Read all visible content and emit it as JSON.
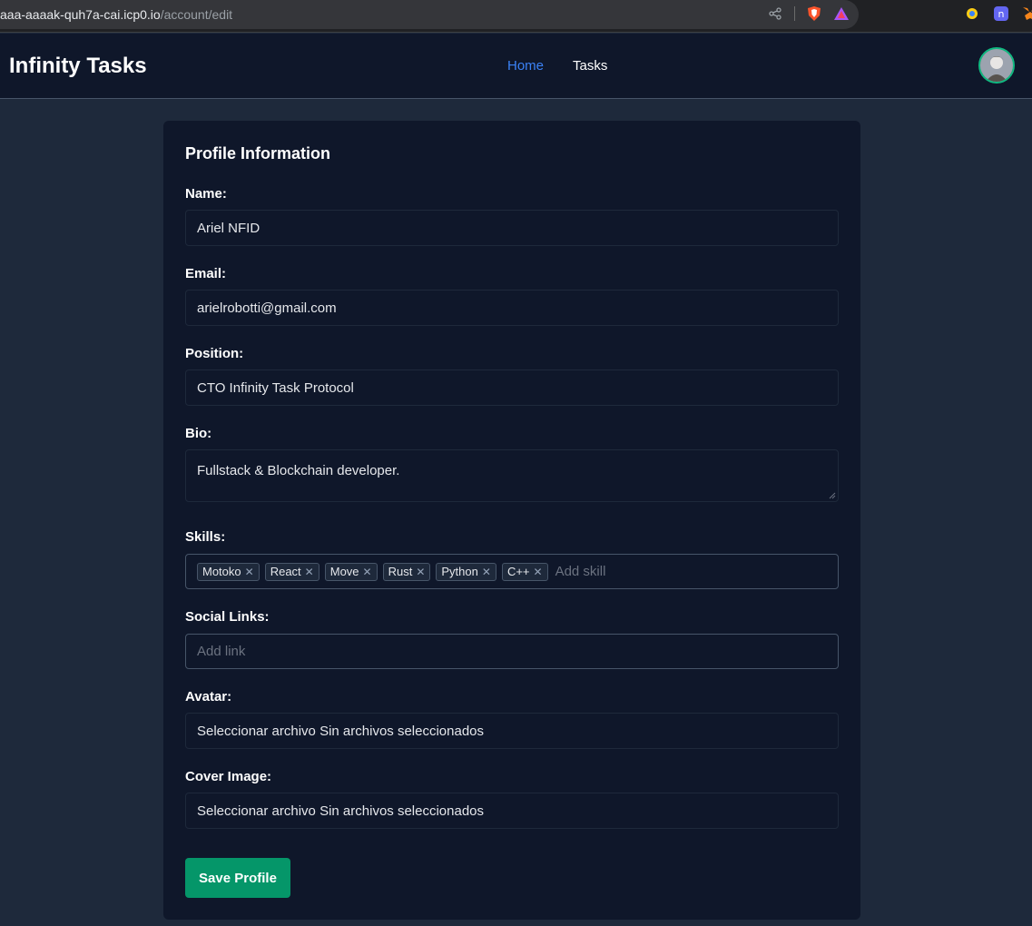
{
  "browser": {
    "url_host": "aaa-aaaak-quh7a-cai.icp0.io",
    "url_path": "/account/edit"
  },
  "nav": {
    "brand": "Infinity Tasks",
    "links": [
      {
        "label": "Home",
        "active": true
      },
      {
        "label": "Tasks",
        "active": false
      }
    ]
  },
  "profile": {
    "title": "Profile Information",
    "name_label": "Name:",
    "name_value": "Ariel NFID",
    "email_label": "Email:",
    "email_value": "arielrobotti@gmail.com",
    "position_label": "Position:",
    "position_value": "CTO Infinity Task Protocol",
    "bio_label": "Bio:",
    "bio_value": "Fullstack &  Blockchain developer.",
    "skills_label": "Skills:",
    "skills": [
      "Motoko",
      "React",
      "Move",
      "Rust",
      "Python",
      "C++"
    ],
    "skills_placeholder": "Add skill",
    "social_label": "Social Links:",
    "social_placeholder": "Add link",
    "avatar_label": "Avatar:",
    "avatar_file_button": "Seleccionar archivo",
    "avatar_file_status": "Sin archivos seleccionados",
    "cover_label": "Cover Image:",
    "cover_file_button": "Seleccionar archivo",
    "cover_file_status": "Sin archivos seleccionados",
    "save_label": "Save Profile"
  },
  "colors": {
    "accent": "#3b82f6",
    "save": "#059669",
    "card": "#0f172a",
    "page": "#1e293b"
  }
}
